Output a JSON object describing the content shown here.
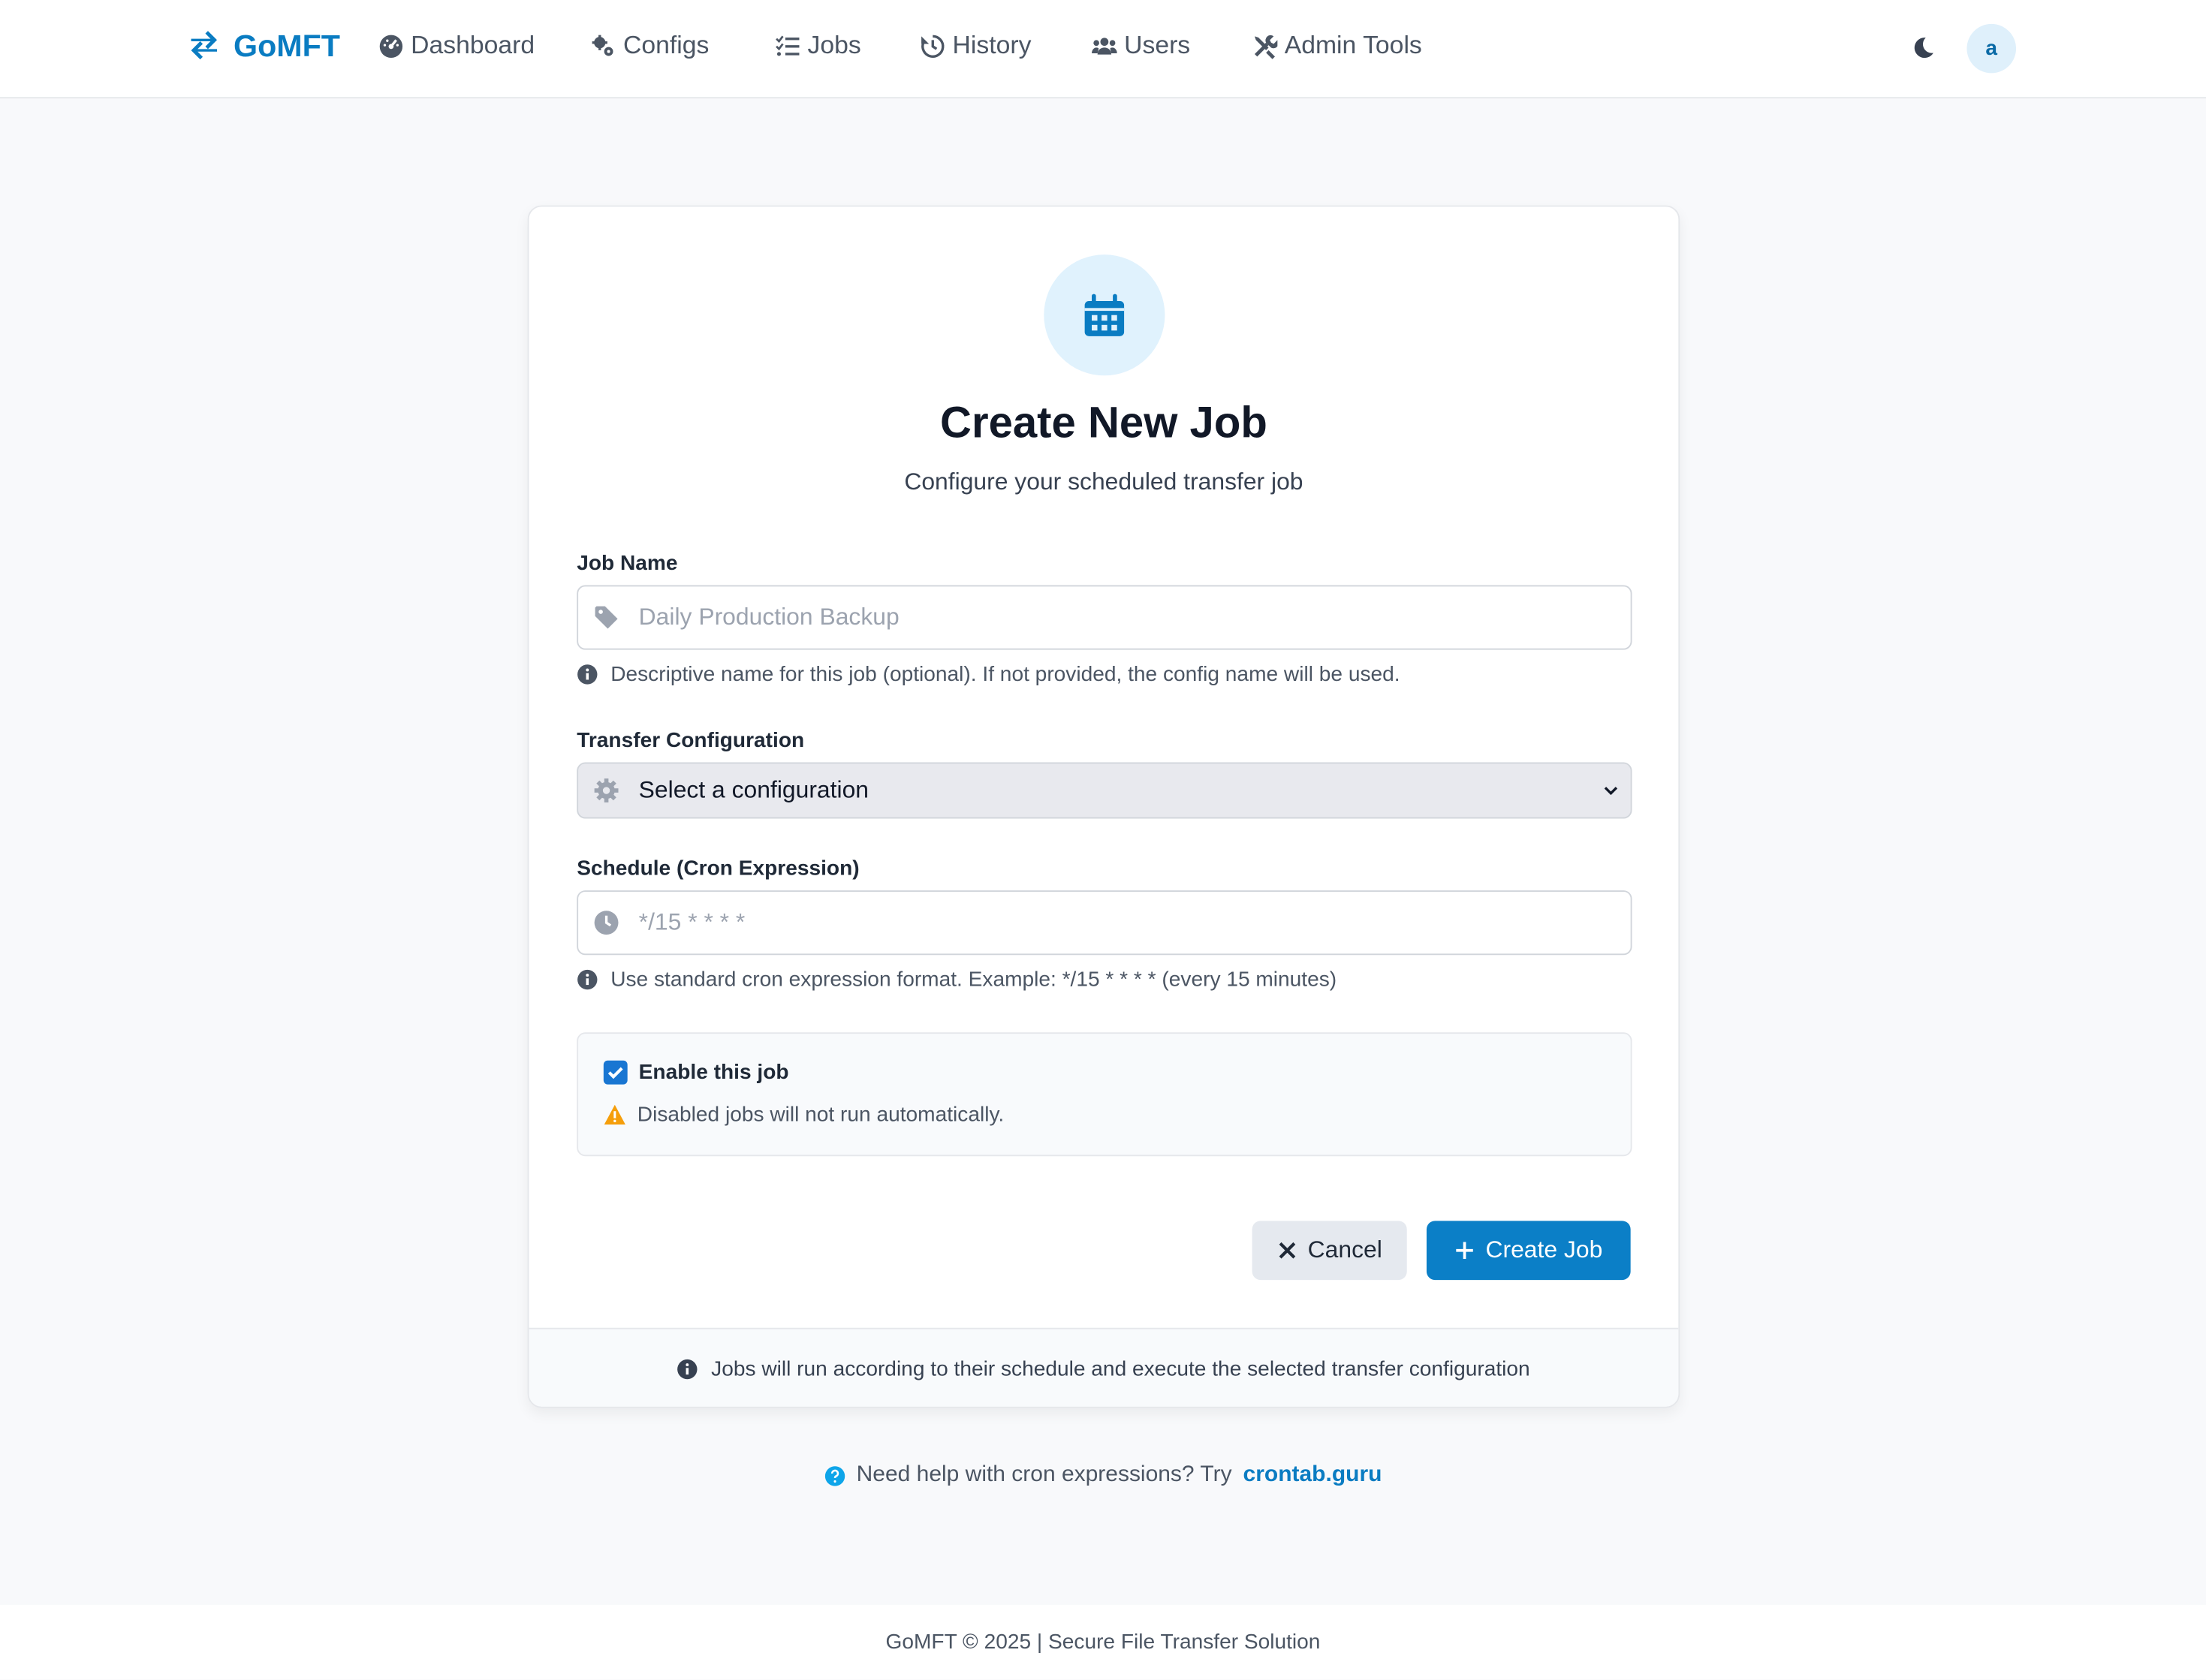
{
  "nav": {
    "brand": "GoMFT",
    "items": [
      {
        "label": "Dashboard",
        "icon": "gauge-icon"
      },
      {
        "label": "Configs",
        "icon": "cogs-icon"
      },
      {
        "label": "Jobs",
        "icon": "list-check-icon"
      },
      {
        "label": "History",
        "icon": "history-icon"
      },
      {
        "label": "Users",
        "icon": "users-icon"
      },
      {
        "label": "Admin Tools",
        "icon": "tools-icon"
      }
    ],
    "avatar": "a"
  },
  "form": {
    "title": "Create New Job",
    "subtitle": "Configure your scheduled transfer job",
    "job_name": {
      "label": "Job Name",
      "placeholder": "Daily Production Backup",
      "help": "Descriptive name for this job (optional). If not provided, the config name will be used."
    },
    "config": {
      "label": "Transfer Configuration",
      "selected": "Select a configuration"
    },
    "schedule": {
      "label": "Schedule (Cron Expression)",
      "placeholder": "*/15 * * * *",
      "help": "Use standard cron expression format. Example: */15 * * * * (every 15 minutes)"
    },
    "enable": {
      "label": "Enable this job",
      "checked": true,
      "warning": "Disabled jobs will not run automatically."
    },
    "cancel_label": "Cancel",
    "create_label": "Create Job",
    "footer_note": "Jobs will run according to their schedule and execute the selected transfer configuration"
  },
  "help": {
    "text": "Need help with cron expressions? Try",
    "link": "crontab.guru"
  },
  "footer": "GoMFT © 2025 | Secure File Transfer Solution",
  "colors": {
    "brand": "#0a7cc2",
    "primary_button": "#0b7fc7",
    "checkbox": "#1976d2",
    "warning": "#f59e0b"
  }
}
